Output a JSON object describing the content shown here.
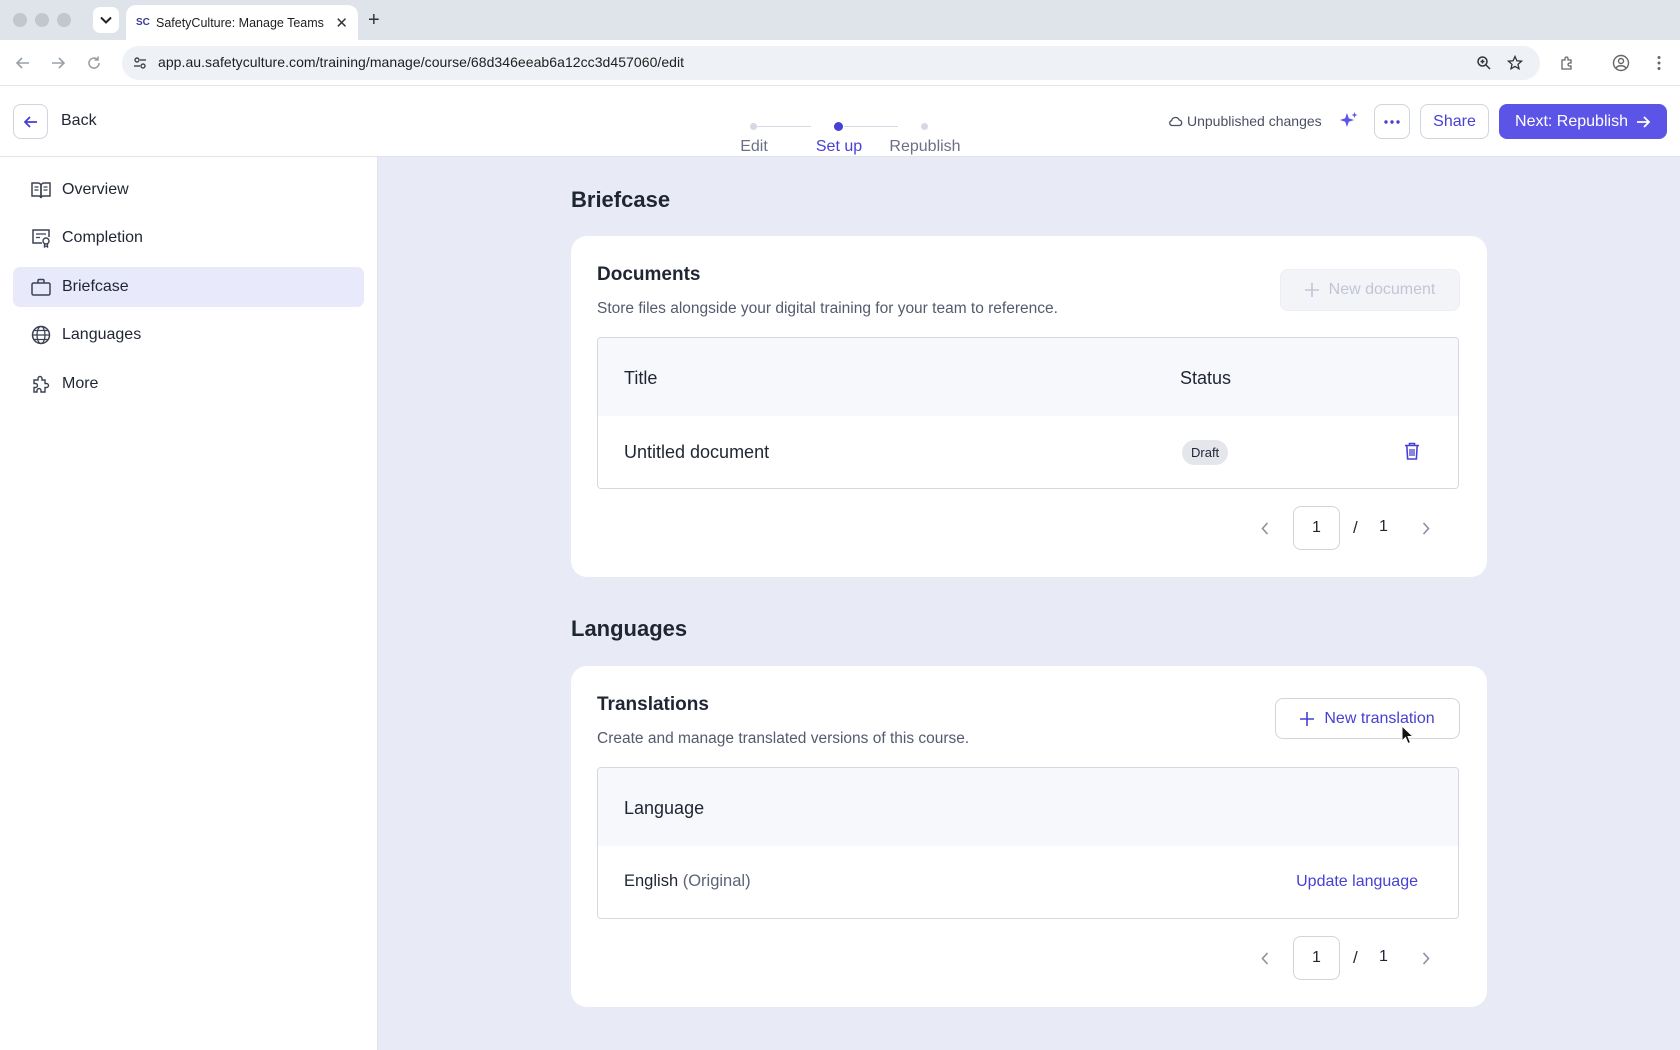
{
  "browser": {
    "tab_title": "SafetyCulture: Manage Teams",
    "favicon_text": "SC",
    "url": "app.au.safetyculture.com/training/manage/course/68d346eeab6a12cc3d457060/edit"
  },
  "header": {
    "back_label": "Back",
    "steps": [
      {
        "label": "Edit",
        "state": "done"
      },
      {
        "label": "Set up",
        "state": "active"
      },
      {
        "label": "Republish",
        "state": "pending"
      }
    ],
    "status": "Unpublished changes",
    "more_label": "···",
    "share_label": "Share",
    "next_label": "Next: Republish",
    "accent_color": "#5b54e6"
  },
  "sidebar": {
    "items": [
      {
        "label": "Overview",
        "icon": "book-icon",
        "active": false
      },
      {
        "label": "Completion",
        "icon": "certificate-icon",
        "active": false
      },
      {
        "label": "Briefcase",
        "icon": "briefcase-icon",
        "active": true
      },
      {
        "label": "Languages",
        "icon": "globe-icon",
        "active": false
      },
      {
        "label": "More",
        "icon": "puzzle-icon",
        "active": false
      }
    ]
  },
  "briefcase": {
    "section_title": "Briefcase",
    "card_title": "Documents",
    "description": "Store files alongside your digital training for your team to reference.",
    "new_button": "New document",
    "columns": [
      "Title",
      "Status"
    ],
    "rows": [
      {
        "title": "Untitled document",
        "status": "Draft"
      }
    ],
    "pager": {
      "page": "1",
      "separator": "/",
      "total": "1"
    }
  },
  "languages": {
    "section_title": "Languages",
    "card_title": "Translations",
    "description": "Create and manage translated versions of this course.",
    "new_button": "New translation",
    "columns": [
      "Language"
    ],
    "rows": [
      {
        "language": "English",
        "note": "(Original)",
        "action": "Update language"
      }
    ],
    "pager": {
      "page": "1",
      "separator": "/",
      "total": "1"
    }
  }
}
